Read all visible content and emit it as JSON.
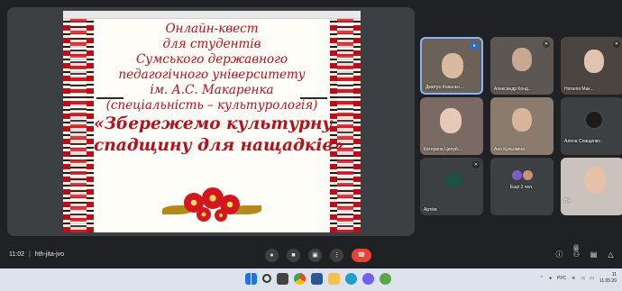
{
  "slide": {
    "topbar_label": "",
    "lines": [
      "Онлайн-квест",
      "для студентів",
      "Сумського державного",
      "педагогічного університету",
      "ім. А.С. Макаренка",
      "(спеціальність – культурологія)"
    ],
    "title_lines": [
      "«Збережемо культурну",
      "спадщину для нащадків»"
    ]
  },
  "participants": [
    {
      "name": "Дмитро Ковальч...",
      "speaking": true,
      "bg": "#6b6158"
    },
    {
      "name": "Александр Конд...",
      "speaking": false,
      "bg": "#5d5753"
    },
    {
      "name": "Наталія Мак...",
      "speaking": false,
      "bg": "#4a4540"
    },
    {
      "name": "Катерина Цилуй...",
      "speaking": false,
      "bg": "#7a6a63"
    },
    {
      "name": "Аня Кульоміна",
      "speaking": false,
      "bg": "#8a7b6d"
    },
    {
      "name": "Алена Слащенко",
      "speaking": false,
      "bg": "#3c4043"
    },
    {
      "name": "Артём",
      "speaking": false,
      "bg": "#3c4043"
    },
    {
      "name": "Ещё 2 чел.",
      "speaking": false,
      "bg": "#3c4043"
    },
    {
      "name": "Вы",
      "speaking": false,
      "bg": "#c9c3bb"
    }
  ],
  "bottom_bar": {
    "time": "11:02",
    "separator": "|",
    "meeting_code": "hth-jita-jvo",
    "participant_count": "11"
  },
  "taskbar": {
    "lang": "РУС",
    "clock_time": "11",
    "clock_date": "11.05.20"
  },
  "colors": {
    "accent": "#1a73e8",
    "end_call": "#ea4335",
    "slide_text": "#b3121d"
  }
}
